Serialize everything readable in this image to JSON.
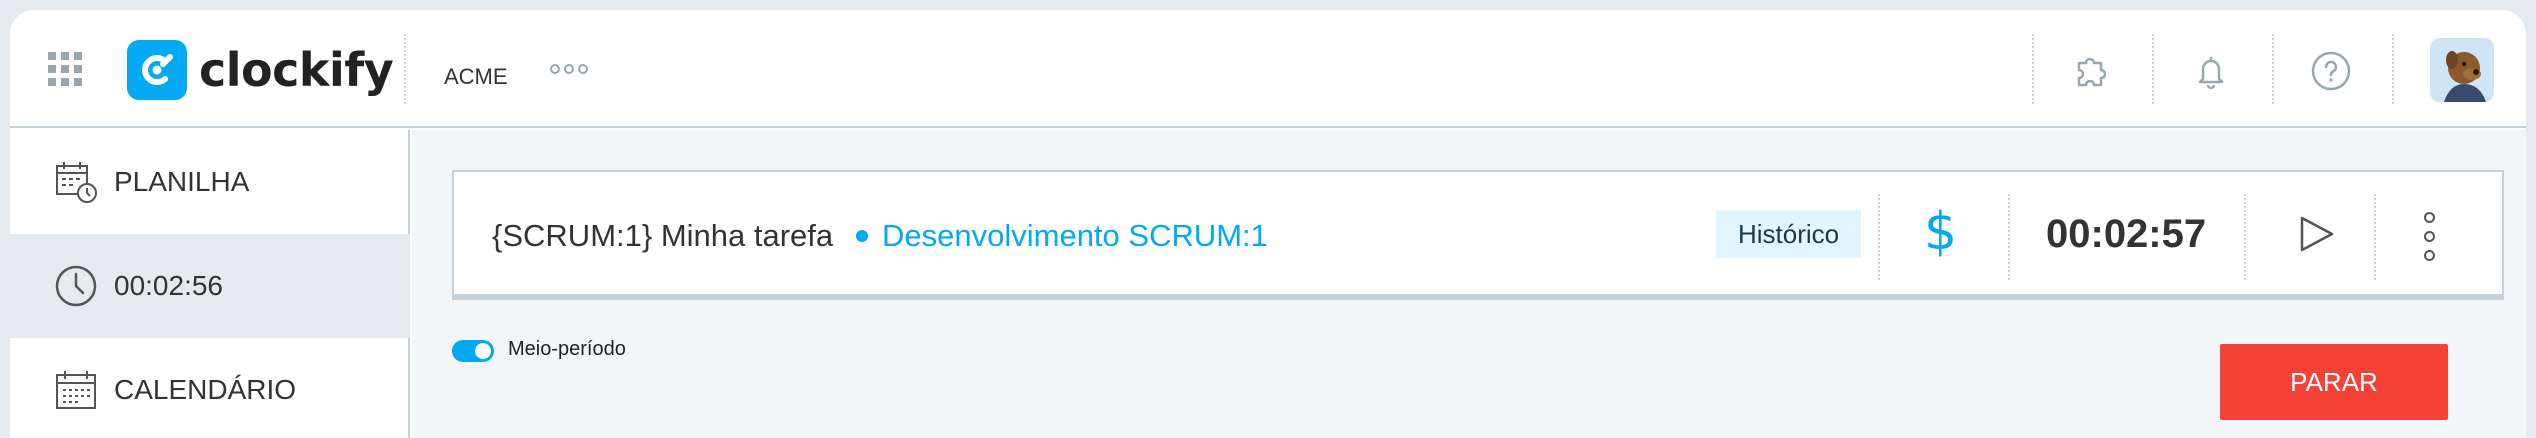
{
  "header": {
    "logo_text": "clockify",
    "workspace": "ACME"
  },
  "sidebar": {
    "items": [
      {
        "label": "PLANILHA",
        "icon": "timesheet-icon",
        "active": false
      },
      {
        "label": "00:02:56",
        "icon": "clock-icon",
        "active": true
      },
      {
        "label": "CALENDÁRIO",
        "icon": "calendar-icon",
        "active": false
      }
    ]
  },
  "entry": {
    "description": "{SCRUM:1} Minha tarefa",
    "project": "Desenvolvimento SCRUM:1",
    "tag": "Histórico",
    "billable_symbol": "$",
    "duration": "00:02:57"
  },
  "toggle": {
    "label": "Meio-período",
    "on": true
  },
  "stop_button": {
    "label": "PARAR"
  },
  "colors": {
    "accent": "#03a9f4",
    "stop": "#f44336",
    "tag_bg": "#e1f5fe",
    "border": "#c6d2d9",
    "sidebar_active": "#e4eaee"
  }
}
